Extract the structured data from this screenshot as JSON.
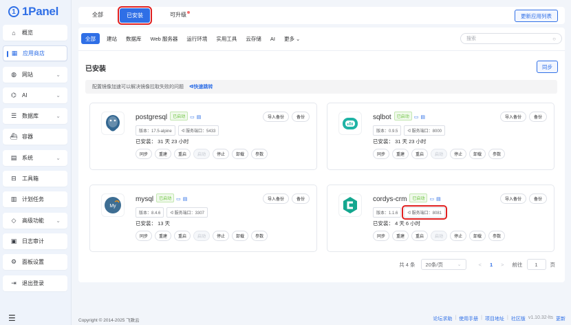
{
  "brand": {
    "logo_text": "1Panel"
  },
  "sidebar": {
    "items": [
      {
        "label": "概览",
        "icon": "home-icon",
        "glyph": "⌂",
        "chevron": false
      },
      {
        "label": "应用商店",
        "icon": "grid-icon",
        "glyph": "▦",
        "chevron": false,
        "active": true
      },
      {
        "label": "网站",
        "icon": "globe-icon",
        "glyph": "◍",
        "chevron": true
      },
      {
        "label": "AI",
        "icon": "robot-icon",
        "glyph": "⌬",
        "chevron": true
      },
      {
        "label": "数据库",
        "icon": "database-icon",
        "glyph": "☰",
        "chevron": true
      },
      {
        "label": "容器",
        "icon": "whale-icon",
        "glyph": "⛴",
        "chevron": false
      },
      {
        "label": "系统",
        "icon": "system-icon",
        "glyph": "▤",
        "chevron": true
      },
      {
        "label": "工具箱",
        "icon": "toolbox-icon",
        "glyph": "⊟",
        "chevron": false
      },
      {
        "label": "计划任务",
        "icon": "calendar-icon",
        "glyph": "▥",
        "chevron": false
      },
      {
        "label": "高级功能",
        "icon": "diamond-icon",
        "glyph": "◇",
        "chevron": true
      },
      {
        "label": "日志审计",
        "icon": "log-icon",
        "glyph": "▣",
        "chevron": false
      },
      {
        "label": "面板设置",
        "icon": "settings-icon",
        "glyph": "⚙",
        "chevron": false
      },
      {
        "label": "退出登录",
        "icon": "logout-icon",
        "glyph": "⇥",
        "chevron": false
      }
    ]
  },
  "topbar": {
    "tab_all": "全部",
    "tab_installed": "已安装",
    "tab_upgradable": "可升级",
    "update_button": "更新应用列表"
  },
  "categories": [
    "全部",
    "建站",
    "数据库",
    "Web 服务器",
    "运行环境",
    "实用工具",
    "云存储",
    "AI",
    "更多 ⌄"
  ],
  "search": {
    "placeholder": "搜索"
  },
  "section": {
    "title": "已安装",
    "sync_button": "同步",
    "notice": "配置镜像加速可以解决镜像拉取失败的问题",
    "notice_link": "ᐊ快速跳转"
  },
  "apps": [
    {
      "name": "postgresql",
      "status": "已启动",
      "version": "版本：17.5-alpine",
      "port": "ᐊ 服务端口：5433",
      "installed": "已安装：  31 天 23 小时",
      "icon": "postgresql-logo-icon"
    },
    {
      "name": "sqlbot",
      "status": "已启动",
      "version": "版本：0.9.5",
      "port": "ᐊ 服务端口：8000",
      "installed": "已安装：  31 天 23 小时",
      "icon": "sqlbot-logo-icon"
    },
    {
      "name": "mysql",
      "status": "已启动",
      "version": "版本：8.4.6",
      "port": "ᐊ 服务端口：3307",
      "installed": "已安装：  13 天",
      "icon": "mysql-logo-icon"
    },
    {
      "name": "cordys-crm",
      "status": "已启动",
      "version": "版本：1.1.6",
      "port": "ᐊ 服务端口：8081",
      "installed": "已安装：  4 天 6 小时",
      "icon": "cordys-logo-icon"
    }
  ],
  "card_buttons": {
    "import_backup": "导入备份",
    "backup": "备份"
  },
  "actions": [
    "同步",
    "重建",
    "重启",
    "启动",
    "停止",
    "卸载",
    "参数"
  ],
  "pagination": {
    "total": "共 4 条",
    "page_size": "20条/页",
    "prev": "<",
    "current": "1",
    "next": ">",
    "goto_label": "前往",
    "goto_value": "1",
    "page_unit": "页"
  },
  "footer": {
    "copyright": "Copyright © 2014-2025 飞致云",
    "links": [
      "论坛求助",
      "使用手册",
      "项目地址",
      "社区版"
    ],
    "version": "v1.10.32-lts",
    "update": "更新"
  },
  "colors": {
    "accent": "#2f6fe6",
    "highlight": "#e02020",
    "running": "#67c23a"
  }
}
